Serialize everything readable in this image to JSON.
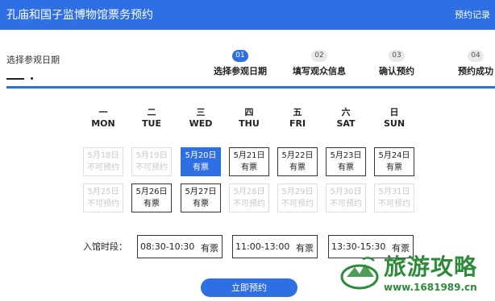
{
  "header": {
    "title": "孔庙和国子监博物馆票务预约",
    "records_link": "预约记录"
  },
  "section": {
    "label": "选择参观日期"
  },
  "steps": [
    {
      "num": "01",
      "label": "选择参观日期",
      "active": true
    },
    {
      "num": "02",
      "label": "填写观众信息",
      "active": false
    },
    {
      "num": "03",
      "label": "确认预约",
      "active": false
    },
    {
      "num": "04",
      "label": "预约成功",
      "active": false
    }
  ],
  "weekdays": [
    {
      "cn": "一",
      "en": "MON"
    },
    {
      "cn": "二",
      "en": "TUE"
    },
    {
      "cn": "三",
      "en": "WED"
    },
    {
      "cn": "四",
      "en": "THU"
    },
    {
      "cn": "五",
      "en": "FRI"
    },
    {
      "cn": "六",
      "en": "SAT"
    },
    {
      "cn": "日",
      "en": "SUN"
    }
  ],
  "calendar": [
    [
      {
        "date": "5月18日",
        "status": "不可预约"
      },
      {
        "date": "5月19日",
        "status": "不可预约"
      },
      {
        "date": "5月20日",
        "status": "有票",
        "selected": true
      },
      {
        "date": "5月21日",
        "status": "有票"
      },
      {
        "date": "5月22日",
        "status": "有票"
      },
      {
        "date": "5月23日",
        "status": "有票"
      },
      {
        "date": "5月24日",
        "status": "有票"
      }
    ],
    [
      {
        "date": "5月25日",
        "status": "不可预约"
      },
      {
        "date": "5月26日",
        "status": "有票"
      },
      {
        "date": "5月27日",
        "status": "有票"
      },
      {
        "date": "5月28日",
        "status": "不可预约"
      },
      {
        "date": "5月29日",
        "status": "不可预约"
      },
      {
        "date": "5月30日",
        "status": "不可预约"
      },
      {
        "date": "5月31日",
        "status": "不可预约"
      }
    ]
  ],
  "time_slots": {
    "label": "入馆时段：",
    "slots": [
      {
        "time": "08:30-10:30",
        "status": "有票"
      },
      {
        "time": "11:00-13:00",
        "status": "有票"
      },
      {
        "time": "13:30-15:30",
        "status": "有票"
      }
    ]
  },
  "submit_label": "立即预约",
  "watermark": {
    "title": "旅游攻略",
    "url": "www.1681989.cn"
  },
  "colors": {
    "primary": "#2f6fe4",
    "watermark": "#2e8b3a"
  }
}
